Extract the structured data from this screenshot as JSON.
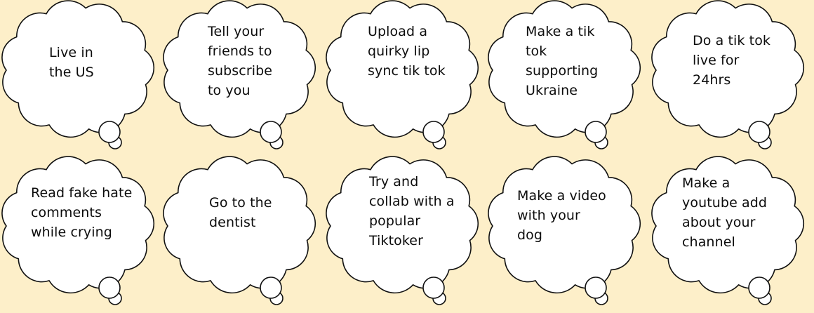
{
  "bubbles": [
    {
      "text": "Live in\nthe US"
    },
    {
      "text": "Tell your\nfriends to\nsubscribe\nto you"
    },
    {
      "text": "Upload a\nquirky lip\nsync tik tok"
    },
    {
      "text": "Make a tik\ntok\nsupporting\nUkraine"
    },
    {
      "text": "Do a tik tok\nlive for\n24hrs"
    },
    {
      "text": "Read fake hate\ncomments\nwhile crying"
    },
    {
      "text": "Go to the\ndentist"
    },
    {
      "text": "Try and\ncollab with a\npopular\nTiktoker"
    },
    {
      "text": "Make a video\nwith your\ndog"
    },
    {
      "text": "Make a\nyoutube add\nabout your\nchannel"
    }
  ]
}
